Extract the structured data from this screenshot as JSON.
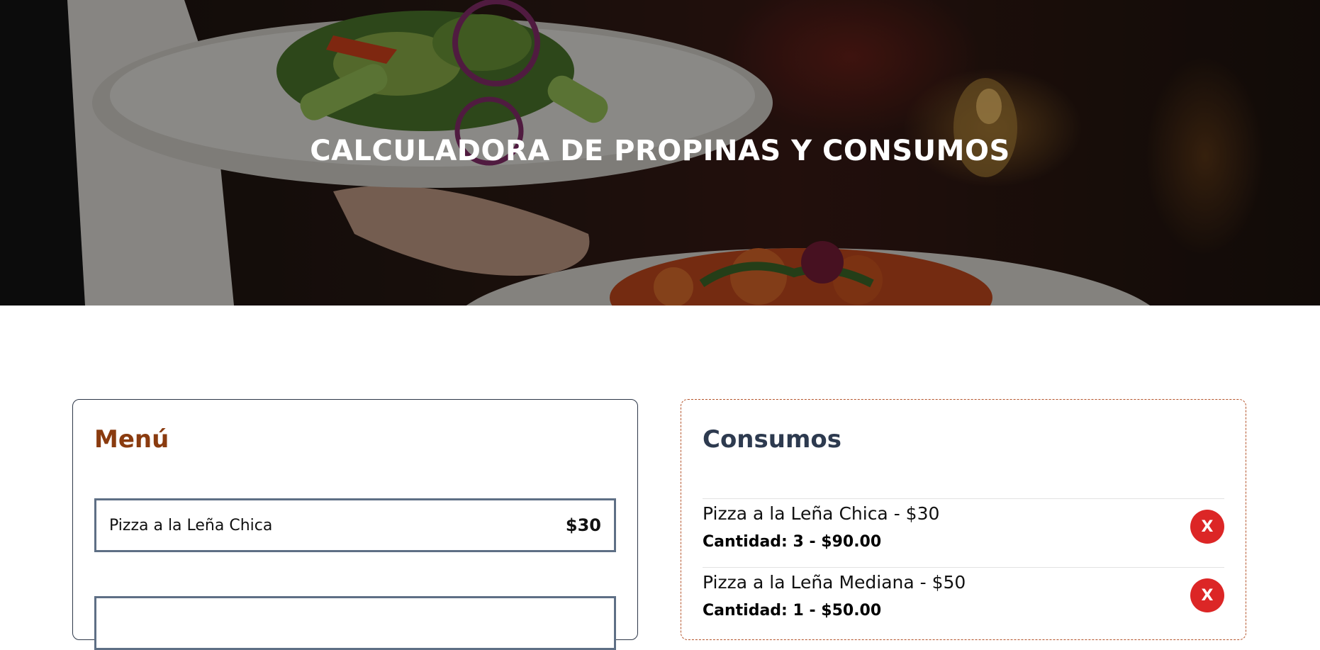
{
  "hero": {
    "title": "CALCULADORA DE PROPINAS Y CONSUMOS"
  },
  "menu": {
    "heading": "Menú",
    "items": [
      {
        "name": "Pizza a la Leña Chica",
        "price": "$30"
      },
      {
        "name": "",
        "price": ""
      }
    ]
  },
  "consumos": {
    "heading": "Consumos",
    "items": [
      {
        "name": "Pizza a la Leña Chica - $30",
        "qty": "Cantidad: 3 - $90.00",
        "remove_label": "X"
      },
      {
        "name": "Pizza a la Leña Mediana - $50",
        "qty": "Cantidad: 1 - $50.00",
        "remove_label": "X"
      }
    ]
  },
  "colors": {
    "menu_heading": "#8a3b0f",
    "consumos_heading": "#2d3a4f",
    "remove_button": "#dc2626",
    "menu_item_border": "#5e6f85"
  }
}
